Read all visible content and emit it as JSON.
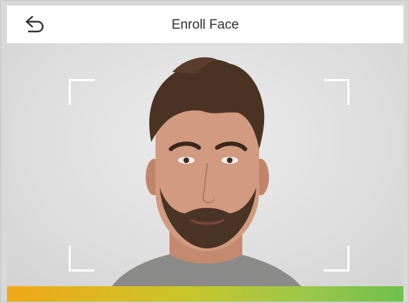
{
  "header": {
    "title": "Enroll Face",
    "back_icon": "back-arrow-icon"
  },
  "camera": {
    "subject": "face-preview",
    "frame_color": "#ffffff"
  },
  "progress": {
    "gradient_colors": [
      "#f2a818",
      "#c9c52a",
      "#9cc84a",
      "#6fc04c"
    ]
  }
}
